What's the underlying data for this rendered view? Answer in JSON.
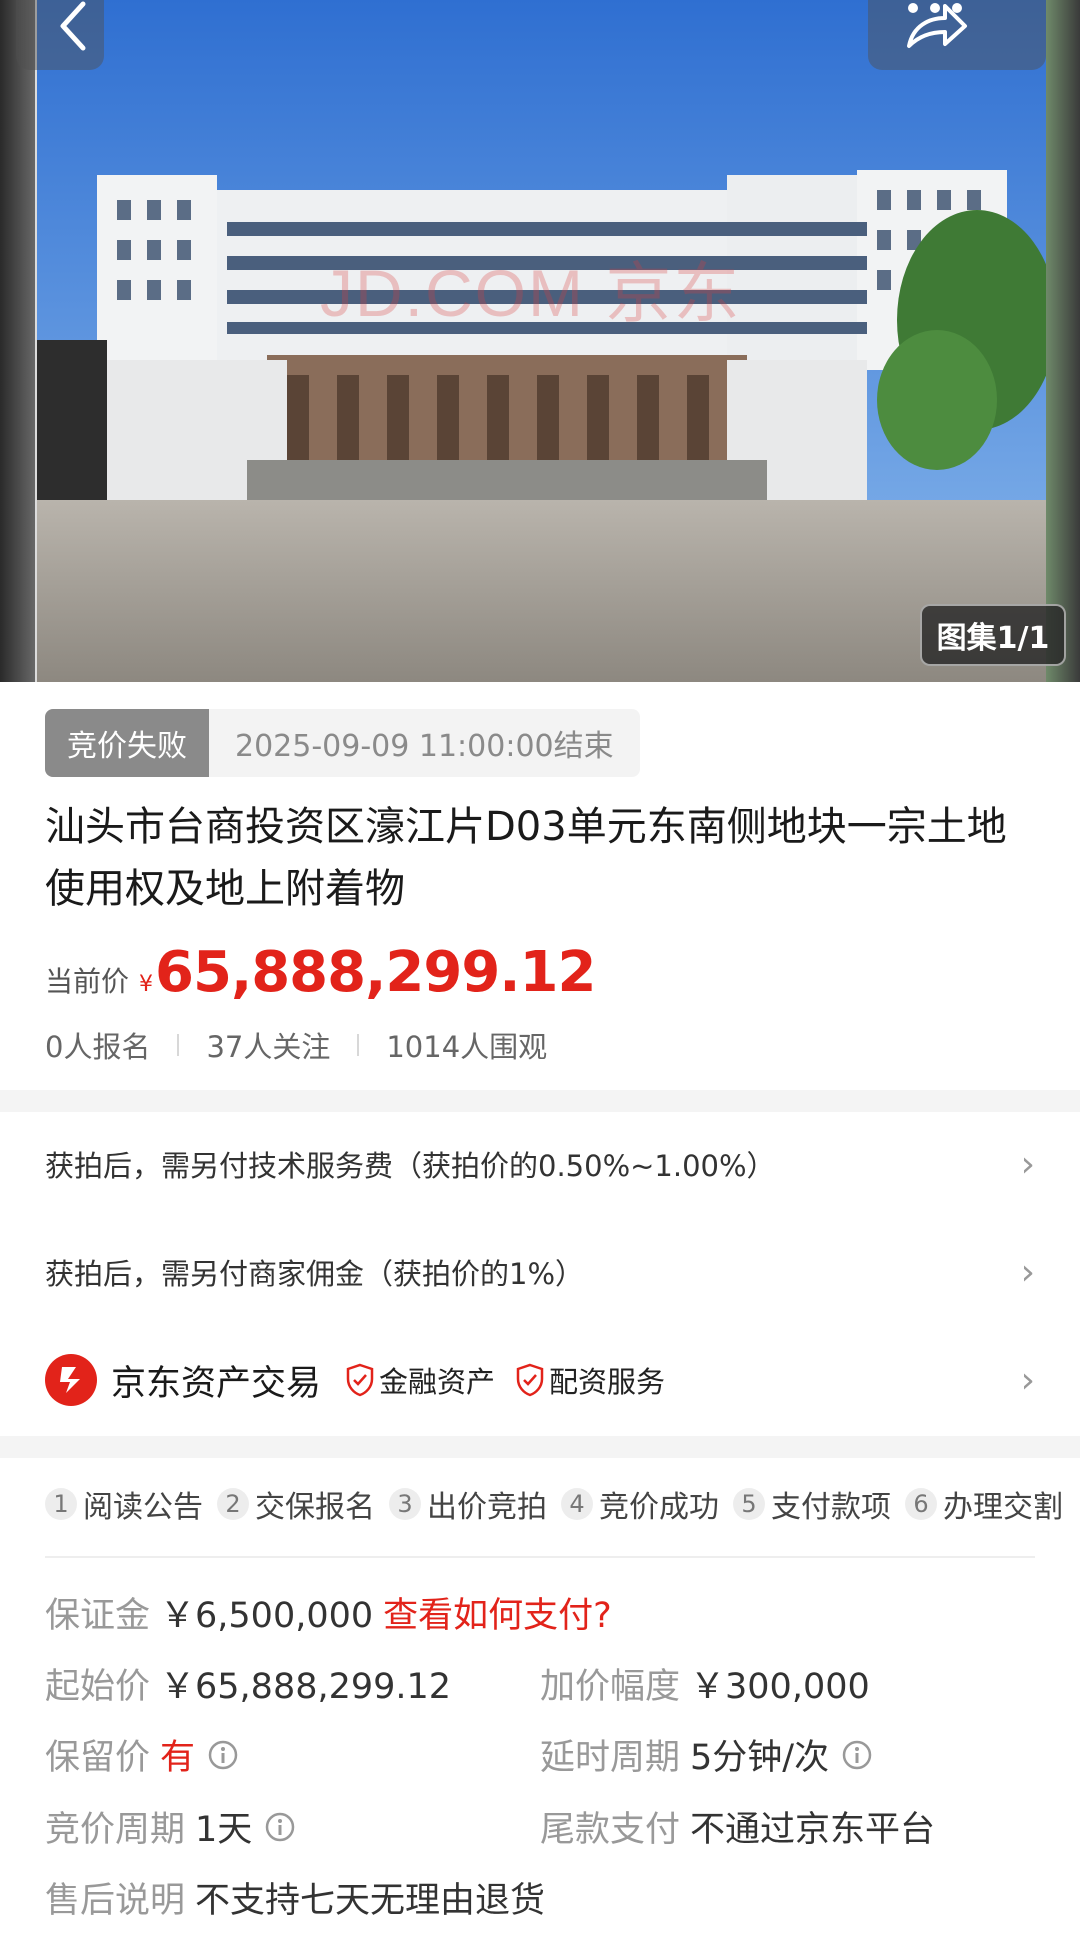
{
  "hero": {
    "watermark": "JD.COM 京东",
    "gallery_label": "图集1/1"
  },
  "status": {
    "badge": "竞价失败",
    "time": "2025-09-09 11:00:00结束"
  },
  "title": "汕头市台商投资区濠江片D03单元东南侧地块一宗土地使用权及地上附着物",
  "price": {
    "label": "当前价",
    "currency": "¥",
    "value": "65,888,299.12"
  },
  "stats": [
    "0人报名",
    "37人关注",
    "1014人围观"
  ],
  "fees": [
    "获拍后，需另付技术服务费（获拍价的0.50%~1.00%）",
    "获拍后，需另付商家佣金（获拍价的1%）"
  ],
  "seller": {
    "name": "京东资产交易",
    "tags": [
      "金融资产",
      "配资服务"
    ]
  },
  "steps": [
    {
      "num": "1",
      "label": "阅读公告"
    },
    {
      "num": "2",
      "label": "交保报名"
    },
    {
      "num": "3",
      "label": "出价竞拍"
    },
    {
      "num": "4",
      "label": "竞价成功"
    },
    {
      "num": "5",
      "label": "支付款项"
    },
    {
      "num": "6",
      "label": "办理交割"
    }
  ],
  "details": {
    "deposit_label": "保证金",
    "deposit_value": "￥6,500,000",
    "deposit_link": "查看如何支付?",
    "start_label": "起始价",
    "start_value": "￥65,888,299.12",
    "increment_label": "加价幅度",
    "increment_value": "￥300,000",
    "reserve_label": "保留价",
    "reserve_value": "有",
    "delay_label": "延时周期",
    "delay_value": "5分钟/次",
    "cycle_label": "竞价周期",
    "cycle_value": "1天",
    "final_label": "尾款支付",
    "final_value": "不通过京东平台",
    "aftersale_label": "售后说明",
    "aftersale_value": "不支持七天无理由退货"
  },
  "colors": {
    "accent_red": "#e2231a",
    "status_gray": "#8a8a8a"
  }
}
